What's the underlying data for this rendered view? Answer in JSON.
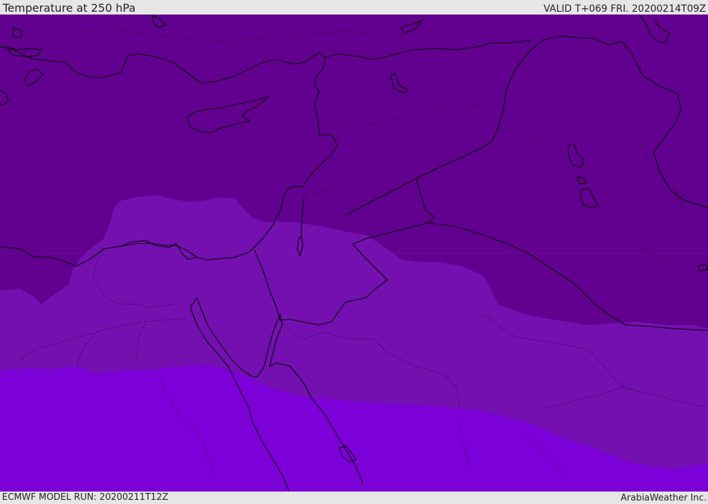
{
  "header": {
    "title": "Temperature at 250 hPa",
    "valid_time": "VALID T+069 FRI. 20200214T09Z"
  },
  "footer": {
    "model_run": "ECMWF MODEL RUN: 20200211T12Z",
    "credit": "ArabiaWeather Inc."
  },
  "map": {
    "field": "temperature",
    "level": "250 hPa",
    "bands": [
      {
        "name": "coldest-band",
        "color": "#62008f"
      },
      {
        "name": "middle-band",
        "color": "#7410b0"
      },
      {
        "name": "warmest-band",
        "color": "#7c00d8"
      }
    ],
    "coastline_color": "#000000",
    "border_style": "dotted"
  }
}
